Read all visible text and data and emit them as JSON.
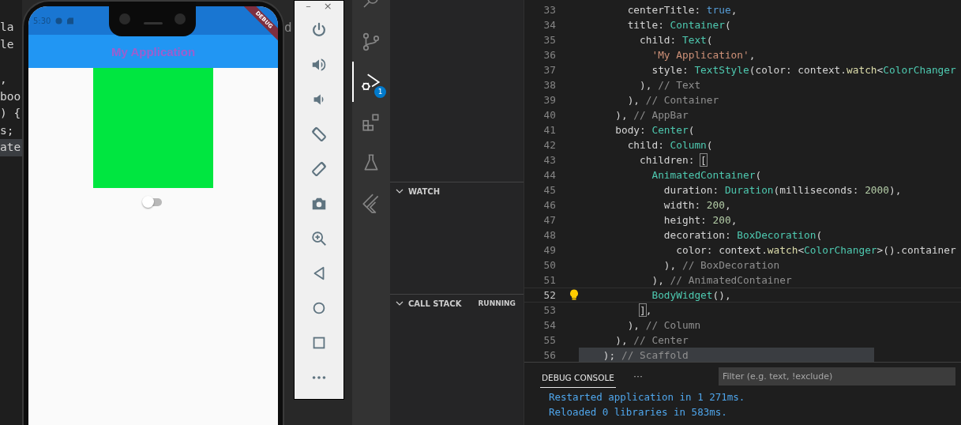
{
  "background_code": {
    "upper_lines": [
      {
        "text": "la",
        "highlighted": false
      },
      {
        "text": "le",
        "highlighted": false
      }
    ],
    "lower_lines": [
      {
        "text": ",",
        "highlighted": false
      },
      {
        "text": "boo",
        "highlighted": false
      },
      {
        "text": ") {",
        "highlighted": false
      },
      {
        "text": "s;",
        "highlighted": false
      },
      {
        "text": "ate",
        "highlighted": true
      }
    ],
    "right_fragment": "d"
  },
  "phone": {
    "status_time": "5:30",
    "debug_banner": "DEBUG",
    "app_bar_title": "My Application",
    "switch": {
      "on": false
    }
  },
  "emulator_toolbar": {
    "window_controls": [
      "–",
      "×"
    ],
    "tools": [
      {
        "kind": "power"
      },
      {
        "kind": "volume-up"
      },
      {
        "kind": "volume-down"
      },
      {
        "kind": "rotate-left"
      },
      {
        "kind": "rotate-right"
      },
      {
        "kind": "camera"
      },
      {
        "kind": "zoom"
      },
      {
        "kind": "back"
      },
      {
        "kind": "home"
      },
      {
        "kind": "overview"
      },
      {
        "kind": "more"
      }
    ]
  },
  "activity_bar": [
    {
      "kind": "search",
      "selected": false
    },
    {
      "kind": "source-control",
      "selected": false
    },
    {
      "kind": "debug",
      "selected": true,
      "badge": "1"
    },
    {
      "kind": "extensions",
      "selected": false
    },
    {
      "kind": "testing",
      "selected": false
    },
    {
      "kind": "flutter",
      "selected": false
    }
  ],
  "debug_sidebar": {
    "sections": [
      {
        "title": "WATCH",
        "expanded": true
      },
      {
        "title": "CALL STACK",
        "expanded": true,
        "status": "RUNNING"
      }
    ]
  },
  "editor": {
    "lines": [
      {
        "number": "33",
        "current": false,
        "selected": false,
        "lightbulb": false,
        "tokens": [
          {
            "kind": "plain",
            "text": "        centerTitle: "
          },
          {
            "kind": "keyword",
            "text": "true"
          },
          {
            "kind": "plain",
            "text": ","
          }
        ]
      },
      {
        "number": "34",
        "current": false,
        "selected": false,
        "lightbulb": false,
        "tokens": [
          {
            "kind": "plain",
            "text": "        title: "
          },
          {
            "kind": "class",
            "text": "Container"
          },
          {
            "kind": "plain",
            "text": "("
          }
        ]
      },
      {
        "number": "35",
        "current": false,
        "selected": false,
        "lightbulb": false,
        "tokens": [
          {
            "kind": "plain",
            "text": "          child: "
          },
          {
            "kind": "class",
            "text": "Text"
          },
          {
            "kind": "plain",
            "text": "("
          }
        ]
      },
      {
        "number": "36",
        "current": false,
        "selected": false,
        "lightbulb": false,
        "tokens": [
          {
            "kind": "string",
            "text": "            'My Application'"
          },
          {
            "kind": "plain",
            "text": ","
          }
        ]
      },
      {
        "number": "37",
        "current": false,
        "selected": false,
        "lightbulb": false,
        "tokens": [
          {
            "kind": "plain",
            "text": "            style: "
          },
          {
            "kind": "class",
            "text": "TextStyle"
          },
          {
            "kind": "plain",
            "text": "(color: context."
          },
          {
            "kind": "method",
            "text": "watch"
          },
          {
            "kind": "plain",
            "text": "<"
          },
          {
            "kind": "class",
            "text": "ColorChanger"
          }
        ]
      },
      {
        "number": "38",
        "current": false,
        "selected": false,
        "lightbulb": false,
        "tokens": [
          {
            "kind": "plain",
            "text": "          ), "
          },
          {
            "kind": "comment",
            "text": "// Text"
          }
        ]
      },
      {
        "number": "39",
        "current": false,
        "selected": false,
        "lightbulb": false,
        "tokens": [
          {
            "kind": "plain",
            "text": "        ), "
          },
          {
            "kind": "comment",
            "text": "// Container"
          }
        ]
      },
      {
        "number": "40",
        "current": false,
        "selected": false,
        "lightbulb": false,
        "tokens": [
          {
            "kind": "plain",
            "text": "      ), "
          },
          {
            "kind": "comment",
            "text": "// AppBar"
          }
        ]
      },
      {
        "number": "41",
        "current": false,
        "selected": false,
        "lightbulb": false,
        "tokens": [
          {
            "kind": "plain",
            "text": "      body: "
          },
          {
            "kind": "class",
            "text": "Center"
          },
          {
            "kind": "plain",
            "text": "("
          }
        ]
      },
      {
        "number": "42",
        "current": false,
        "selected": false,
        "lightbulb": false,
        "tokens": [
          {
            "kind": "plain",
            "text": "        child: "
          },
          {
            "kind": "class",
            "text": "Column"
          },
          {
            "kind": "plain",
            "text": "("
          }
        ]
      },
      {
        "number": "43",
        "current": false,
        "selected": false,
        "lightbulb": false,
        "tokens": [
          {
            "kind": "plain",
            "text": "          children: "
          },
          {
            "kind": "bracket",
            "text": "[",
            "selected": true
          }
        ]
      },
      {
        "number": "44",
        "current": false,
        "selected": false,
        "lightbulb": false,
        "tokens": [
          {
            "kind": "class",
            "text": "            AnimatedContainer"
          },
          {
            "kind": "plain",
            "text": "("
          }
        ]
      },
      {
        "number": "45",
        "current": false,
        "selected": false,
        "lightbulb": false,
        "tokens": [
          {
            "kind": "plain",
            "text": "              duration: "
          },
          {
            "kind": "class",
            "text": "Duration"
          },
          {
            "kind": "plain",
            "text": "(milliseconds: "
          },
          {
            "kind": "number",
            "text": "2000"
          },
          {
            "kind": "plain",
            "text": "),"
          }
        ]
      },
      {
        "number": "46",
        "current": false,
        "selected": false,
        "lightbulb": false,
        "tokens": [
          {
            "kind": "plain",
            "text": "              width: "
          },
          {
            "kind": "number",
            "text": "200"
          },
          {
            "kind": "plain",
            "text": ","
          }
        ]
      },
      {
        "number": "47",
        "current": false,
        "selected": false,
        "lightbulb": false,
        "tokens": [
          {
            "kind": "plain",
            "text": "              height: "
          },
          {
            "kind": "number",
            "text": "200"
          },
          {
            "kind": "plain",
            "text": ","
          }
        ]
      },
      {
        "number": "48",
        "current": false,
        "selected": false,
        "lightbulb": false,
        "tokens": [
          {
            "kind": "plain",
            "text": "              decoration: "
          },
          {
            "kind": "class",
            "text": "BoxDecoration"
          },
          {
            "kind": "plain",
            "text": "("
          }
        ]
      },
      {
        "number": "49",
        "current": false,
        "selected": false,
        "lightbulb": false,
        "tokens": [
          {
            "kind": "plain",
            "text": "                color: context."
          },
          {
            "kind": "method",
            "text": "watch"
          },
          {
            "kind": "plain",
            "text": "<"
          },
          {
            "kind": "class",
            "text": "ColorChanger"
          },
          {
            "kind": "plain",
            "text": ">().container"
          }
        ]
      },
      {
        "number": "50",
        "current": false,
        "selected": false,
        "lightbulb": false,
        "tokens": [
          {
            "kind": "plain",
            "text": "              ), "
          },
          {
            "kind": "comment",
            "text": "// BoxDecoration"
          }
        ]
      },
      {
        "number": "51",
        "current": false,
        "selected": false,
        "lightbulb": false,
        "tokens": [
          {
            "kind": "plain",
            "text": "            ), "
          },
          {
            "kind": "comment",
            "text": "// AnimatedContainer"
          }
        ]
      },
      {
        "number": "52",
        "current": true,
        "selected": false,
        "lightbulb": true,
        "tokens": [
          {
            "kind": "class",
            "text": "            BodyWidget"
          },
          {
            "kind": "plain",
            "text": "(),"
          }
        ]
      },
      {
        "number": "53",
        "current": false,
        "selected": false,
        "lightbulb": false,
        "tokens": [
          {
            "kind": "bracket",
            "text": "          ]",
            "selected": true
          },
          {
            "kind": "plain",
            "text": ","
          }
        ]
      },
      {
        "number": "54",
        "current": false,
        "selected": false,
        "lightbulb": false,
        "tokens": [
          {
            "kind": "plain",
            "text": "        ), "
          },
          {
            "kind": "comment",
            "text": "// Column"
          }
        ]
      },
      {
        "number": "55",
        "current": false,
        "selected": false,
        "lightbulb": false,
        "tokens": [
          {
            "kind": "plain",
            "text": "      ), "
          },
          {
            "kind": "comment",
            "text": "// Center"
          }
        ]
      },
      {
        "number": "56",
        "current": false,
        "selected": true,
        "lightbulb": false,
        "tokens": [
          {
            "kind": "plain",
            "text": "    ); "
          },
          {
            "kind": "comment",
            "text": "// Scaffold"
          }
        ]
      }
    ]
  },
  "debug_console": {
    "tabs": [
      {
        "label": "DEBUG CONSOLE",
        "selected": true
      }
    ],
    "more": "···",
    "filter": {
      "placeholder": "Filter (e.g. text, !exclude)"
    },
    "output": [
      "Restarted application in 1 271ms.",
      "Reloaded 0 libraries in 583ms."
    ]
  }
}
